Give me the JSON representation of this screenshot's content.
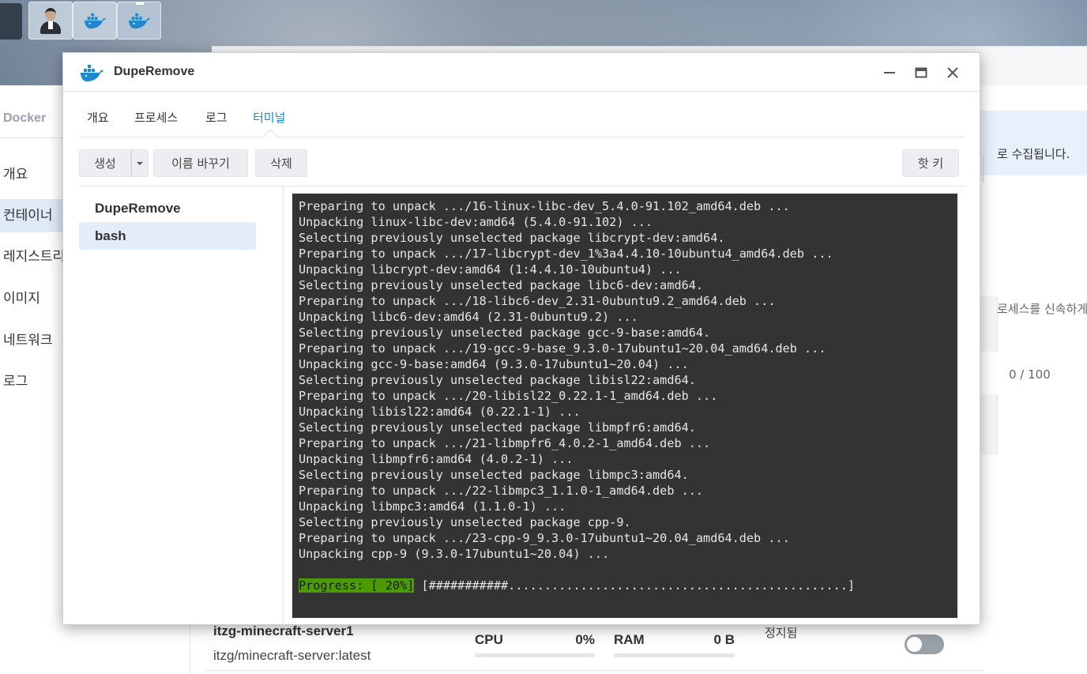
{
  "background_app": {
    "sidebar_title": "Docker",
    "nav_items": [
      "개요",
      "컨테이너",
      "레지스트리",
      "이미지",
      "네트워크",
      "로그"
    ],
    "selected_nav_index": 1,
    "right_text_1": "로 수집됩니다.",
    "right_text_2": "로세스를 신속하게",
    "right_text_3": "0 / 100",
    "container": {
      "name": "itzg-minecraft-server1",
      "image": "itzg/minecraft-server:latest",
      "cpu_label": "CPU",
      "cpu_value": "0%",
      "ram_label": "RAM",
      "ram_value": "0 B",
      "status": "정지됨"
    }
  },
  "window": {
    "title": "DupeRemove",
    "tabs": [
      "개요",
      "프로세스",
      "로그",
      "터미널"
    ],
    "active_tab_index": 3
  },
  "toolbar": {
    "create_label": "생성",
    "rename_label": "이름 바꾸기",
    "delete_label": "삭제",
    "hotkey_label": "핫 키"
  },
  "sessions": [
    "DupeRemove",
    "bash"
  ],
  "selected_session_index": 1,
  "terminal": {
    "lines": [
      "Preparing to unpack .../16-linux-libc-dev_5.4.0-91.102_amd64.deb ...",
      "Unpacking linux-libc-dev:amd64 (5.4.0-91.102) ...",
      "Selecting previously unselected package libcrypt-dev:amd64.",
      "Preparing to unpack .../17-libcrypt-dev_1%3a4.4.10-10ubuntu4_amd64.deb ...",
      "Unpacking libcrypt-dev:amd64 (1:4.4.10-10ubuntu4) ...",
      "Selecting previously unselected package libc6-dev:amd64.",
      "Preparing to unpack .../18-libc6-dev_2.31-0ubuntu9.2_amd64.deb ...",
      "Unpacking libc6-dev:amd64 (2.31-0ubuntu9.2) ...",
      "Selecting previously unselected package gcc-9-base:amd64.",
      "Preparing to unpack .../19-gcc-9-base_9.3.0-17ubuntu1~20.04_amd64.deb ...",
      "Unpacking gcc-9-base:amd64 (9.3.0-17ubuntu1~20.04) ...",
      "Selecting previously unselected package libisl22:amd64.",
      "Preparing to unpack .../20-libisl22_0.22.1-1_amd64.deb ...",
      "Unpacking libisl22:amd64 (0.22.1-1) ...",
      "Selecting previously unselected package libmpfr6:amd64.",
      "Preparing to unpack .../21-libmpfr6_4.0.2-1_amd64.deb ...",
      "Unpacking libmpfr6:amd64 (4.0.2-1) ...",
      "Selecting previously unselected package libmpc3:amd64.",
      "Preparing to unpack .../22-libmpc3_1.1.0-1_amd64.deb ...",
      "Unpacking libmpc3:amd64 (1.1.0-1) ...",
      "Selecting previously unselected package cpp-9.",
      "Preparing to unpack .../23-cpp-9_9.3.0-17ubuntu1~20.04_amd64.deb ...",
      "Unpacking cpp-9 (9.3.0-17ubuntu1~20.04) ..."
    ],
    "progress_label": "Progress: [ 20%]",
    "progress_bar": " [###########...............................................]"
  },
  "colors": {
    "accent": "#0a8bd6",
    "terminal_bg": "#333333",
    "progress_green": "#4e9a06"
  },
  "icons": [
    "user-avatar-icon",
    "docker-whale-icon",
    "minimize-icon",
    "maximize-icon",
    "close-icon",
    "dropdown-caret-icon"
  ]
}
